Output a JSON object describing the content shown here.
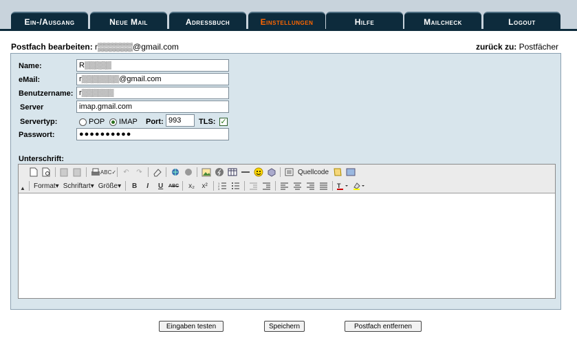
{
  "nav": {
    "tabs": [
      {
        "label": "Ein-/Ausgang"
      },
      {
        "label": "Neue Mail"
      },
      {
        "label": "Adressbuch"
      },
      {
        "label": "Einstellungen"
      },
      {
        "label": "Hilfe"
      },
      {
        "label": "Mailcheck"
      },
      {
        "label": "Logout"
      }
    ],
    "active_tab": "Einstellungen",
    "active_color": "#ff6600"
  },
  "header": {
    "title_label": "Postfach bearbeiten:",
    "title_value": "r▒▒▒▒▒▒@gmail.com",
    "back_label": "zurück zu:",
    "back_link": "Postfächer"
  },
  "form": {
    "name_label": "Name:",
    "name_value": "R▒▒▒▒▒",
    "email_label": "eMail:",
    "email_value": "r▒▒▒▒▒▒▒@gmail.com",
    "user_label": "Benutzername:",
    "user_value": "r▒▒▒▒▒▒",
    "server_label": "Server",
    "server_value": "imap.gmail.com",
    "servertype_label": "Servertyp:",
    "pop_label": "POP",
    "imap_label": "IMAP",
    "selected_type": "IMAP",
    "port_label": "Port:",
    "port_value": "993",
    "tls_label": "TLS:",
    "tls_checked": true,
    "password_label": "Passwort:",
    "password_value": "●●●●●●●●●●",
    "signature_label": "Unterschrift:"
  },
  "editor": {
    "source_label": "Quellcode",
    "format_label": "Format",
    "font_label": "Schriftart",
    "size_label": "Größe",
    "bold": "B",
    "italic": "I",
    "underline": "U",
    "strike": "ABC",
    "subscript": "x₂",
    "superscript": "x²"
  },
  "buttons": {
    "test": "Eingaben testen",
    "save": "Speichern",
    "delete": "Postfach entfernen"
  }
}
